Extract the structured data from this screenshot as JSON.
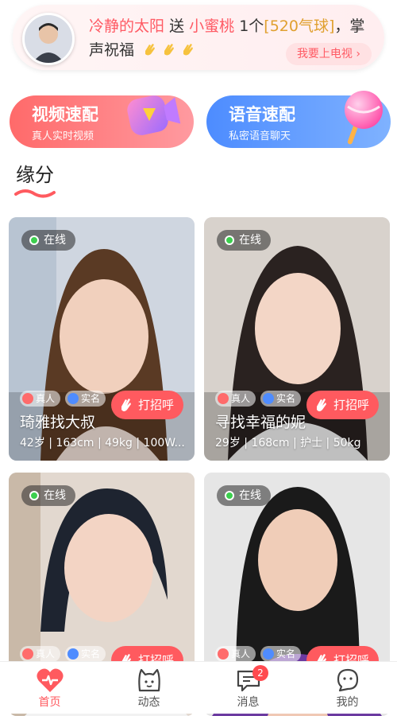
{
  "banner": {
    "sender": "冷静的太阳",
    "verb": "送",
    "receiver": "小蜜桃",
    "count": "1个",
    "gift": "[520气球]",
    "tail": "，掌声祝福",
    "tv_button": "我要上电视 ›"
  },
  "matches": [
    {
      "title": "视频速配",
      "subtitle": "真人实时视频"
    },
    {
      "title": "语音速配",
      "subtitle": "私密语音聊天"
    }
  ],
  "section": {
    "title": "缘分"
  },
  "profiles": [
    {
      "status": "在线",
      "tag_real": "真人",
      "tag_name": "实名",
      "greet": "打招呼",
      "name": "琦雅找大叔",
      "info": "42岁 | 163cm | 49kg | 100W..."
    },
    {
      "status": "在线",
      "tag_real": "真人",
      "tag_name": "实名",
      "greet": "打招呼",
      "name": "寻找幸福的妮",
      "info": "29岁 | 168cm | 护士 | 50kg"
    },
    {
      "status": "在线",
      "tag_real": "真人",
      "tag_name": "实名",
      "greet": "打招呼",
      "name": "",
      "info": ""
    },
    {
      "status": "在线",
      "tag_real": "真人",
      "tag_name": "实名",
      "greet": "打招呼",
      "name": "",
      "info": ""
    }
  ],
  "nav": [
    {
      "label": "首页",
      "icon": "heart-pulse-icon"
    },
    {
      "label": "动态",
      "icon": "cat-face-icon"
    },
    {
      "label": "消息",
      "icon": "chat-bubble-icon",
      "badge": "2"
    },
    {
      "label": "我的",
      "icon": "smile-bubble-icon"
    }
  ],
  "colors": {
    "accent": "#ff5a5f",
    "voice": "#4d8cff",
    "online": "#3ccf4e"
  }
}
